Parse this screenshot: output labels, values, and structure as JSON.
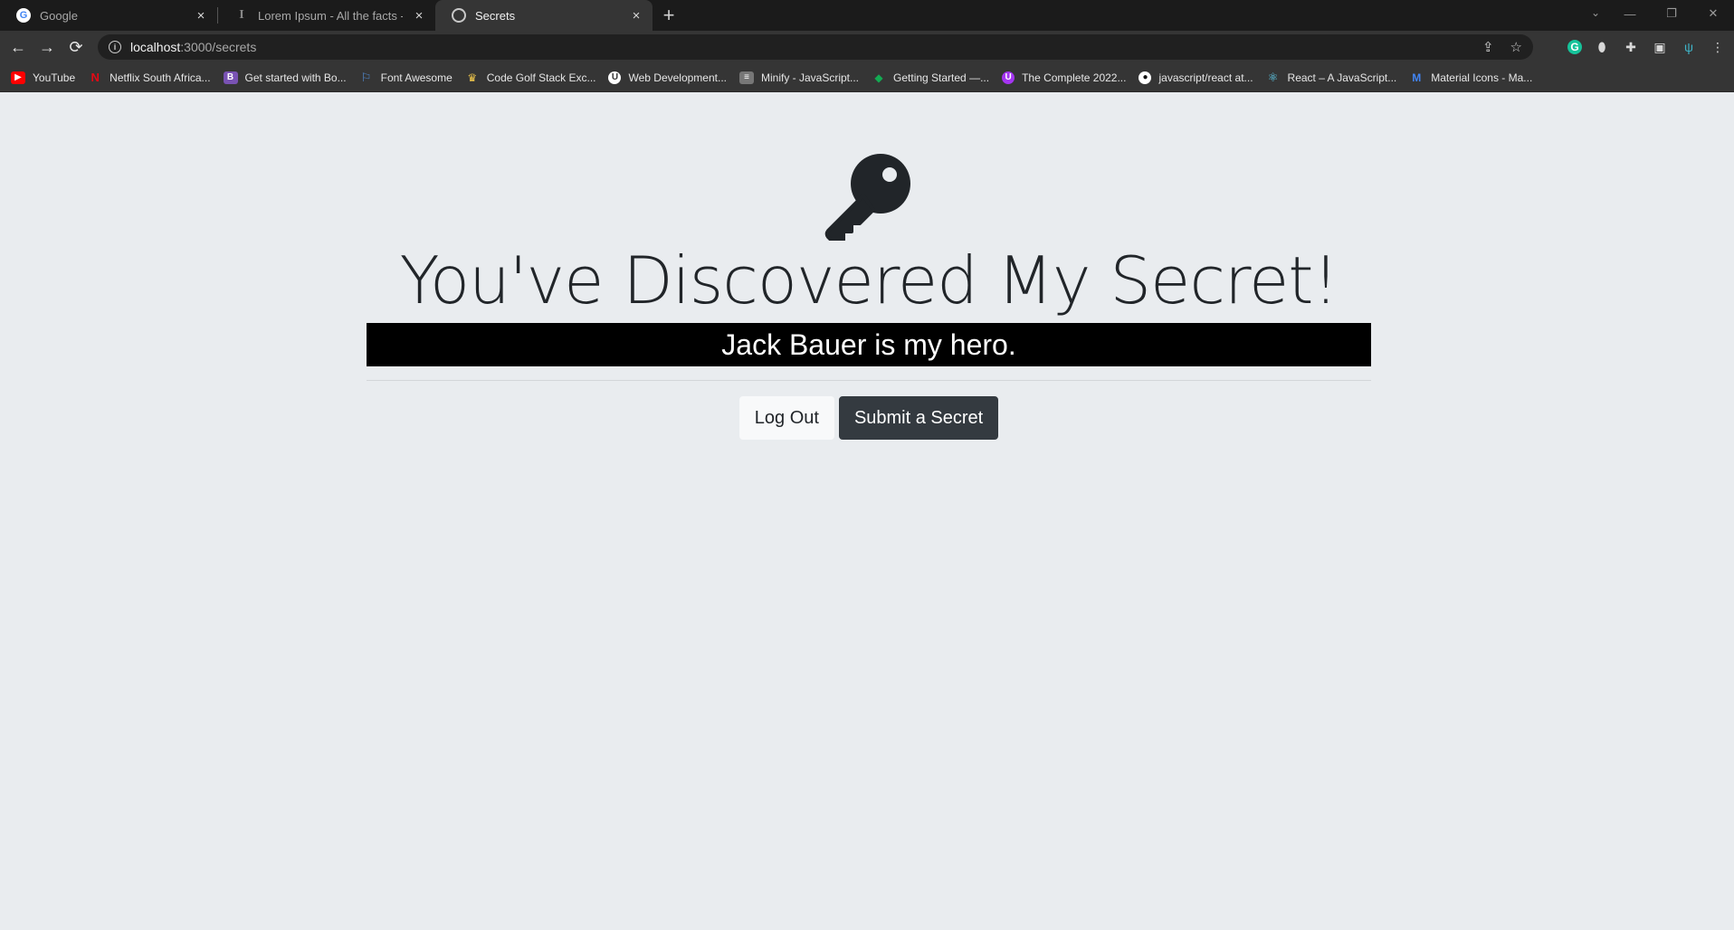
{
  "browser": {
    "tabs": [
      {
        "title": "Google",
        "active": false,
        "icon": "google-icon"
      },
      {
        "title": "Lorem Ipsum - All the facts - Lips",
        "active": false,
        "icon": "lipsum-icon"
      },
      {
        "title": "Secrets",
        "active": true,
        "icon": "globe-icon"
      }
    ],
    "address": {
      "host": "localhost",
      "path": ":3000/secrets"
    },
    "bookmarks": [
      {
        "label": "YouTube",
        "icon": "youtube-icon",
        "color": "#ff0000"
      },
      {
        "label": "Netflix South Africa...",
        "icon": "netflix-icon",
        "color": "#e50914"
      },
      {
        "label": "Get started with Bo...",
        "icon": "bootstrap-icon",
        "color": "#7952b3"
      },
      {
        "label": "Font Awesome",
        "icon": "flag-icon",
        "color": "#528dd7"
      },
      {
        "label": "Code Golf Stack Exc...",
        "icon": "stackexchange-icon",
        "color": "#f2c94c"
      },
      {
        "label": "Web Development...",
        "icon": "udemy-icon",
        "color": "#ffffff"
      },
      {
        "label": "Minify - JavaScript...",
        "icon": "minify-icon",
        "color": "#777777"
      },
      {
        "label": "Getting Started —...",
        "icon": "mongodb-icon",
        "color": "#13aa52"
      },
      {
        "label": "The Complete 2022...",
        "icon": "course-icon",
        "color": "#a435f0"
      },
      {
        "label": "javascript/react at...",
        "icon": "github-icon",
        "color": "#ffffff"
      },
      {
        "label": "React – A JavaScript...",
        "icon": "react-icon",
        "color": "#61dafb"
      },
      {
        "label": "Material Icons - Ma...",
        "icon": "material-icon",
        "color": "#4285f4"
      }
    ]
  },
  "page": {
    "headline": "You've Discovered My Secret!",
    "secret": "Jack Bauer is my hero.",
    "buttons": {
      "logout": "Log Out",
      "submit": "Submit a Secret"
    }
  },
  "colors": {
    "background": "#e9ecef",
    "secret_bg": "#000000",
    "dark_button": "#343a40"
  }
}
